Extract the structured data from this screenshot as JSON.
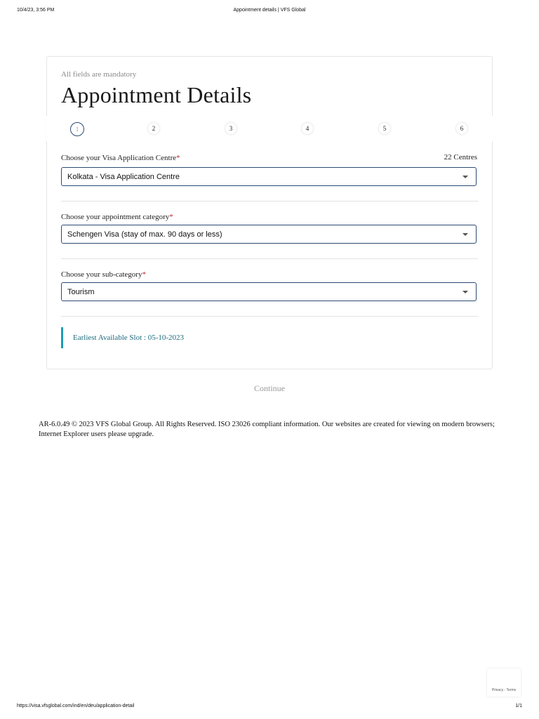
{
  "print_header": {
    "timestamp": "10/4/23, 3:56 PM",
    "title": "Appointment details | VFS Global"
  },
  "print_footer": {
    "url": "https://visa.vfsglobal.com/ind/en/deu/application-detail",
    "pages": "1/1"
  },
  "form": {
    "mandatory_note": "All fields are mandatory",
    "title": "Appointment Details",
    "steps": [
      "1",
      "2",
      "3",
      "4",
      "5",
      "6"
    ],
    "active_step": 1,
    "centre": {
      "label": "Choose your Visa Application Centre",
      "required": "*",
      "count": "22 Centres",
      "value": "Kolkata - Visa Application Centre"
    },
    "category": {
      "label": "Choose your appointment category",
      "required": "*",
      "value": "Schengen Visa (stay of max. 90 days or less)"
    },
    "subcategory": {
      "label": "Choose your sub-category",
      "required": "*",
      "value": "Tourism"
    },
    "earliest_slot": "Earliest Available Slot : 05-10-2023",
    "continue_label": "Continue"
  },
  "footer": {
    "copyright": "AR-6.0.49 © 2023 VFS Global Group. All Rights Reserved. ISO 23026 compliant information. Our websites are created for viewing on modern browsers; Internet Explorer users please upgrade."
  },
  "recaptcha": {
    "links": "Privacy - Terms"
  },
  "colors": {
    "accent_border": "#2c4a73",
    "slot_bar": "#1e9bb5",
    "required": "#c0272d"
  }
}
